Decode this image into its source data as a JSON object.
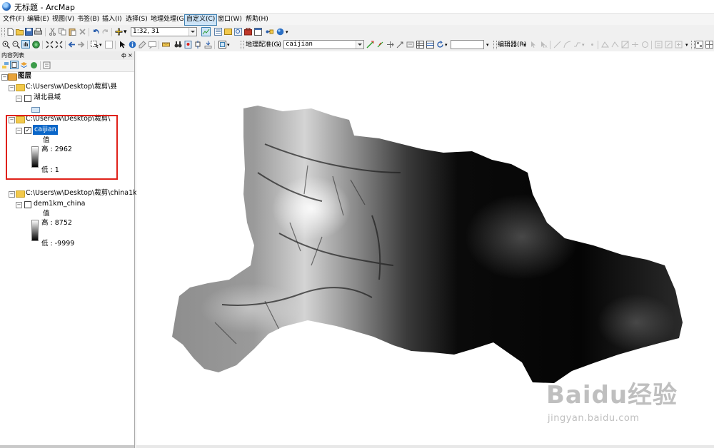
{
  "window": {
    "title": "无标题 - ArcMap"
  },
  "menu": [
    {
      "label": "文件(F)",
      "active": false
    },
    {
      "label": "编辑(E)",
      "active": false
    },
    {
      "label": "视图(V)",
      "active": false
    },
    {
      "label": "书签(B)",
      "active": false
    },
    {
      "label": "插入(I)",
      "active": false
    },
    {
      "label": "选择(S)",
      "active": false
    },
    {
      "label": "地理处理(G)",
      "active": false
    },
    {
      "label": "自定义(C)",
      "active": true
    },
    {
      "label": "窗口(W)",
      "active": false
    },
    {
      "label": "帮助(H)",
      "active": false
    }
  ],
  "toolbar1": {
    "scale_value": "1:32, 31"
  },
  "toolbar2": {
    "georef_label": "地理配准(G)",
    "georef_layer": "caijian",
    "editor_label": "编辑器(R)"
  },
  "toc": {
    "title": "内容列表",
    "pin": "ф",
    "close": "×",
    "root_label": "图层",
    "group1": {
      "label": "C:\\Users\\w\\Desktop\\裁剪\\县",
      "layer": "湖北县域"
    },
    "group2": {
      "label": "C:\\Users\\w\\Desktop\\裁剪\\",
      "layer": "caijian",
      "value_heading": "值",
      "high": "高 : 2962",
      "low": "低 : 1"
    },
    "group3": {
      "label": "C:\\Users\\w\\Desktop\\裁剪\\china1k",
      "layer": "dem1km_china",
      "value_heading": "值",
      "high": "高 : 8752",
      "low": "低 : -9999"
    }
  },
  "watermark": {
    "brand": "Baidu经验",
    "url": "jingyan.baidu.com"
  },
  "colors": {
    "selection": "#0a66c8",
    "highlight_border": "#e0211a",
    "folder": "#f2c94c"
  }
}
